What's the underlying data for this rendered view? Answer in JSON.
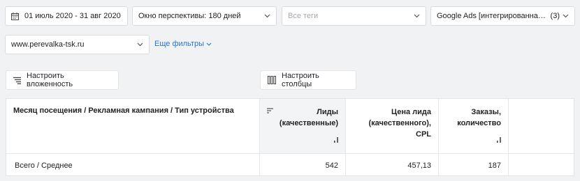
{
  "filters": {
    "date_range": "01 июль 2020 - 31 авг 2020",
    "window": "Окно перспективы:  180 дней",
    "tags_placeholder": "Все теги",
    "source": "Google Ads [интегрированная ...",
    "source_count": "(3)",
    "site": "www.perevalka-tsk.ru",
    "more_filters": "Еще фильтры"
  },
  "toolbar": {
    "nesting": "Настроить вложенность",
    "columns": "Настроить столбцы"
  },
  "table": {
    "headers": {
      "dimension": "Месяц посещения / Рекламная кампания / Тип устройства",
      "leads": [
        "Лиды",
        "(качественные)"
      ],
      "cpl": [
        "Цена лида",
        "(качественного),",
        "CPL"
      ],
      "orders": [
        "Заказы,",
        "количество"
      ]
    },
    "total_row": {
      "label": "Всего / Среднее",
      "leads": "542",
      "cpl": "457,13",
      "orders": "187"
    }
  },
  "colors": {
    "link": "#2a74c9",
    "sorted_column_bg": "#f3f4f6"
  }
}
